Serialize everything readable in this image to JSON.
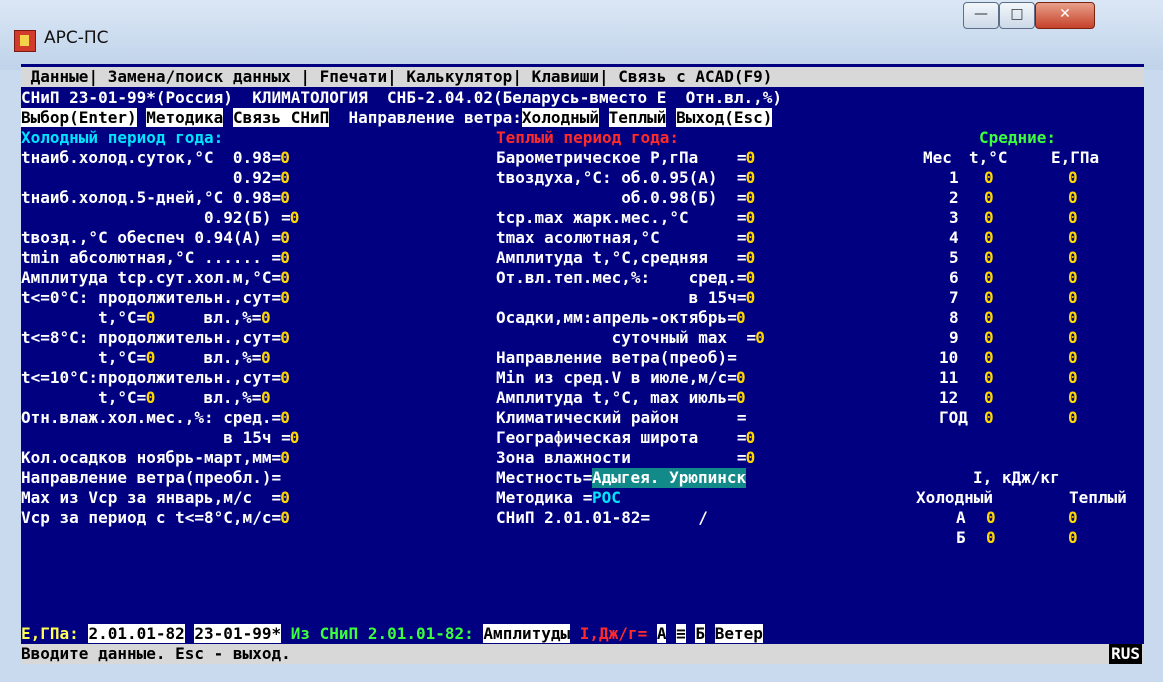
{
  "window": {
    "title": "АРС-ПС",
    "min": "—",
    "max": "□",
    "close": "✕"
  },
  "menu": {
    "items": [
      "Данные",
      "Замена/поиск данных",
      "Fпечати",
      "Калькулятор",
      "Клавиши",
      "Связь с ACAD(F9)"
    ]
  },
  "frame_title": "СНиП 23-01-99*(Россия)  КЛИМАТОЛОГИЯ  СНБ-2.04.02(Беларусь-вместо E  Отн.вл.,%)",
  "buttons": {
    "select": "Выбор(Enter)",
    "method": "Методика",
    "link": "Связь СНиП",
    "wind_label": "Направление ветра:",
    "cold": "Холодный",
    "warm": "Теплый",
    "exit": "Выход(Esc)"
  },
  "headers": {
    "cold": "Холодный период года:",
    "warm": "Теплый период года:",
    "avg": "Средние:",
    "mes": "Мес",
    "t": "t,°C",
    "e": "E,ГПа"
  },
  "cold_rows": [
    {
      "label": "tнаиб.холод.суток,°C  0.98=",
      "value": "0"
    },
    {
      "label": "                      0.92=",
      "value": "0"
    },
    {
      "label": "tнаиб.холод.5-дней,°C 0.98=",
      "value": "0"
    },
    {
      "label": "                   0.92(Б) =",
      "value": "0"
    },
    {
      "label": "tвозд.,°C обеспеч 0.94(А) =",
      "value": "0"
    },
    {
      "label": "tmin абсолютная,°C ...... =",
      "value": "0"
    },
    {
      "label": "Амплитуда tср.сут.хол.м,°C=",
      "value": "0"
    },
    {
      "label": "t<=0°C: продолжительн.,сут=",
      "value": "0"
    },
    {
      "label": "        t,°C=",
      "value": "0",
      "label2": "     вл.,%=",
      "value2": "0"
    },
    {
      "label": "t<=8°C: продолжительн.,сут=",
      "value": "0"
    },
    {
      "label": "        t,°C=",
      "value": "0",
      "label2": "     вл.,%=",
      "value2": "0"
    },
    {
      "label": "t<=10°C:продолжительн.,сут=",
      "value": "0"
    },
    {
      "label": "        t,°C=",
      "value": "0",
      "label2": "     вл.,%=",
      "value2": "0"
    },
    {
      "label": "Отн.влаж.хол.мес.,%: сред.=",
      "value": "0"
    },
    {
      "label": "                     в 15ч =",
      "value": "0"
    },
    {
      "label": "Кол.осадков ноябрь-март,мм=",
      "value": "0"
    },
    {
      "label": "Направление ветра(преобл.)=",
      "value": ""
    },
    {
      "label": "Max из Vср за январь,м/с  =",
      "value": "0"
    },
    {
      "label": "Vср за период с t<=8°C,м/с=",
      "value": "0"
    }
  ],
  "warm_rows": [
    {
      "label": "Барометрическое Р,гПа    =",
      "value": "0"
    },
    {
      "label": "tвоздуха,°C: об.0.95(А)  =",
      "value": "0"
    },
    {
      "label": "             об.0.98(Б)  =",
      "value": "0"
    },
    {
      "label": "tср.max жарк.мес.,°C     =",
      "value": "0"
    },
    {
      "label": "tmax асолютная,°C        =",
      "value": "0"
    },
    {
      "label": "Амплитуда t,°C,средняя   =",
      "value": "0"
    },
    {
      "label": "От.вл.теп.мес,%:    сред.=",
      "value": "0"
    },
    {
      "label": "                    в 15ч=",
      "value": "0"
    },
    {
      "label": "Осадки,мм:апрель-октябрь=",
      "value": "0"
    },
    {
      "label": "            суточный max  =",
      "value": "0"
    },
    {
      "label": "Направление ветра(преоб)=",
      "value": ""
    },
    {
      "label": "Min из сред.V в июле,м/с=",
      "value": "0"
    },
    {
      "label": "Амплитуда t,°C, max июль=",
      "value": "0"
    },
    {
      "label": "Климатический район      =",
      "value": ""
    },
    {
      "label": "Географическая широта    =",
      "value": "0"
    },
    {
      "label": "Зона влажности           =",
      "value": "0"
    },
    {
      "label": "Местность=",
      "value": "Адыгея. Урюпинск"
    },
    {
      "label": "Методика =",
      "value": "РОС"
    },
    {
      "label": "СНиП 2.01.01-82=     /",
      "value": ""
    }
  ],
  "months": [
    {
      "m": "1",
      "t": "0",
      "e": "0"
    },
    {
      "m": "2",
      "t": "0",
      "e": "0"
    },
    {
      "m": "3",
      "t": "0",
      "e": "0"
    },
    {
      "m": "4",
      "t": "0",
      "e": "0"
    },
    {
      "m": "5",
      "t": "0",
      "e": "0"
    },
    {
      "m": "6",
      "t": "0",
      "e": "0"
    },
    {
      "m": "7",
      "t": "0",
      "e": "0"
    },
    {
      "m": "8",
      "t": "0",
      "e": "0"
    },
    {
      "m": "9",
      "t": "0",
      "e": "0"
    },
    {
      "m": "10",
      "t": "0",
      "e": "0"
    },
    {
      "m": "11",
      "t": "0",
      "e": "0"
    },
    {
      "m": "12",
      "t": "0",
      "e": "0"
    },
    {
      "m": "ГОД",
      "t": "0",
      "e": "0"
    }
  ],
  "ie": {
    "title": "I, кДж/кг",
    "cold": "Холодный",
    "warm": "Теплый",
    "rows": [
      {
        "k": "А",
        "c": "0",
        "w": "0"
      },
      {
        "k": "Б",
        "c": "0",
        "w": "0"
      }
    ]
  },
  "bottom": {
    "e": "E,ГПа:",
    "b1": "2.01.01-82",
    "b2": "23-01-99*",
    "from": "Из СНиП 2.01.01-82:",
    "ampl": "Амплитуды",
    "i": "I,Дж/г=",
    "a": "А",
    "sep": "≡",
    "b": "Б",
    "wind": "Ветер"
  },
  "status": {
    "text": "Вводите данные. Esc - выход.",
    "lang": "RUS"
  },
  "colors": {
    "bg": "#000080",
    "cyan": "#00e5ff",
    "red": "#ff2a2a",
    "green": "#3cff3c",
    "field": "#ffd700"
  }
}
